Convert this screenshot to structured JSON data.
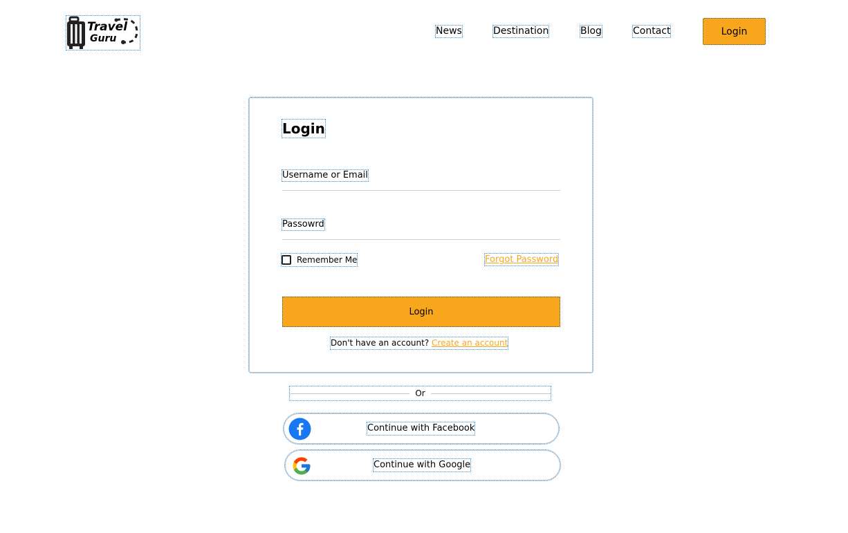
{
  "brand": {
    "line1": "Travel",
    "line2": "Guru"
  },
  "nav": {
    "items": [
      {
        "label": "News"
      },
      {
        "label": "Destination"
      },
      {
        "label": "Blog"
      },
      {
        "label": "Contact"
      }
    ],
    "login_label": "Login"
  },
  "form": {
    "title": "Login",
    "username_placeholder": "Username or Email",
    "password_placeholder": "Passowrd",
    "remember_label": "Remember Me",
    "forgot_label": "Forgot Password",
    "submit_label": "Login",
    "no_account_text": "Don't have an account?",
    "create_account_label": "Create an account"
  },
  "divider": {
    "text": "Or"
  },
  "social": {
    "facebook_label": "Continue with Facebook",
    "google_label": "Continue with Google"
  },
  "colors": {
    "accent": "#f8a61c",
    "facebook": "#1877f2"
  }
}
